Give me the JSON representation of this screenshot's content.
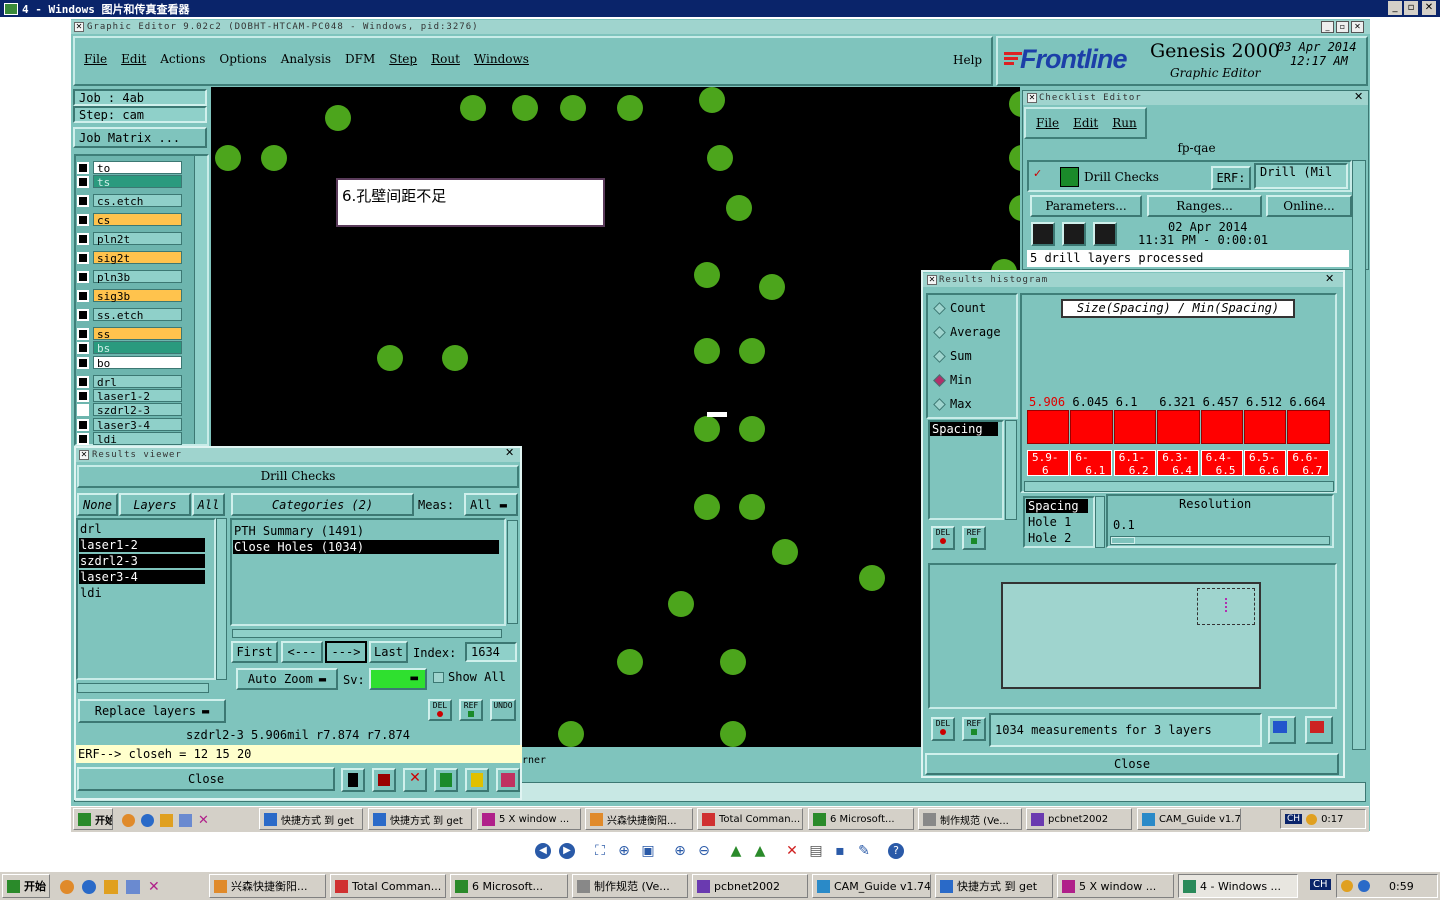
{
  "viewer_title": "4 - Windows 图片和传真查看器",
  "editor": {
    "title": "Graphic Editor 9.02c2 (DOBHT-HTCAM-PC048 - Windows, pid:3276)",
    "menu": [
      "File",
      "Edit",
      "Actions",
      "Options",
      "Analysis",
      "DFM",
      "Step",
      "Rout",
      "Windows"
    ],
    "help": "Help",
    "brand": "Frontline",
    "product": "Genesis 2000",
    "product_sub": "Graphic Editor",
    "date": "03 Apr 2014",
    "time": "12:17 AM",
    "job": "Job : 4ab",
    "step": "Step: cam",
    "job_matrix": "Job Matrix ...",
    "layers": [
      {
        "name": "to",
        "color": "#ffffff"
      },
      {
        "name": "ts",
        "color": "#2a9a7e"
      },
      {
        "name": "cs.etch",
        "color": "#8fd0c9"
      },
      {
        "name": "cs",
        "color": "#ffc34d"
      },
      {
        "name": "pln2t",
        "color": "#8fd0c9"
      },
      {
        "name": "sig2t",
        "color": "#ffc34d"
      },
      {
        "name": "pln3b",
        "color": "#8fd0c9"
      },
      {
        "name": "sig3b",
        "color": "#ffc34d"
      },
      {
        "name": "ss.etch",
        "color": "#8fd0c9"
      },
      {
        "name": "ss",
        "color": "#ffc34d"
      },
      {
        "name": "bs",
        "color": "#2a9a7e"
      },
      {
        "name": "bo",
        "color": "#ffffff"
      },
      {
        "name": "drl",
        "color": "#8fd0c9"
      },
      {
        "name": "laser1-2",
        "color": "#8fd0c9"
      },
      {
        "name": "szdrl2-3",
        "color": "#8fd0c9"
      },
      {
        "name": "laser3-4",
        "color": "#8fd0c9"
      },
      {
        "name": "ldi",
        "color": "#8fd0c9"
      }
    ],
    "annotation": "6.孔壁间距不足",
    "status_fragment": "rner"
  },
  "checklist": {
    "title": "Checklist Editor",
    "menu": [
      "File",
      "Edit",
      "Run"
    ],
    "name": "fp-qae",
    "check_name": "Drill Checks",
    "erf_label": "ERF:",
    "erf_value": "Drill (Mil",
    "params": "Parameters...",
    "ranges": "Ranges...",
    "online": "Online...",
    "run_date": "02 Apr 2014",
    "run_time": "11:31 PM - 0:00:01",
    "status": "5 drill layers processed"
  },
  "histogram": {
    "title": "Results histogram",
    "modes": [
      "Count",
      "Average",
      "Sum",
      "Min",
      "Max"
    ],
    "selected_mode": "Min",
    "header": "Size(Spacing) / Min(Spacing)",
    "spacing_list": [
      "Spacing"
    ],
    "bottom_list": [
      "Spacing",
      "Hole 1",
      "Hole 2"
    ],
    "resolution_label": "Resolution",
    "resolution_value": "0.1",
    "summary": "1034 measurements for 3 layers",
    "close": "Close",
    "del": "DEL",
    "ref": "REF"
  },
  "chart_data": {
    "type": "bar",
    "title": "Size(Spacing) / Min(Spacing)",
    "categories": [
      "5.9-6",
      "6-6.1",
      "6.1-6.2",
      "6.3-6.4",
      "6.4-6.5",
      "6.5-6.6",
      "6.6-6.7"
    ],
    "values": [
      5.906,
      6.045,
      6.1,
      6.321,
      6.457,
      6.512,
      6.664
    ],
    "value_labels": [
      "5.906",
      "6.045",
      "6.1",
      "6.321",
      "6.457",
      "6.512",
      "6.664"
    ],
    "bar_color": "#ff0000"
  },
  "results_viewer": {
    "title": "Results viewer",
    "heading": "Drill Checks",
    "none": "None",
    "layers": "Layers",
    "all": "All",
    "categories": "Categories (2)",
    "meas": "Meas:",
    "meas_value": "All",
    "layer_list": [
      "drl",
      "laser1-2",
      "szdrl2-3",
      "laser3-4",
      "ldi"
    ],
    "selected_layers": [
      "laser1-2",
      "szdrl2-3",
      "laser3-4"
    ],
    "category_list": [
      "PTH Summary (1491)",
      "Close Holes (1034)"
    ],
    "selected_category": "Close Holes (1034)",
    "first": "First",
    "prev": "<---",
    "next": "--->",
    "last": "Last",
    "index_label": "Index:",
    "index_value": "1634",
    "auto_zoom": "Auto Zoom",
    "sv": "Sv:",
    "show_all": "Show All",
    "replace_layers": "Replace layers",
    "del": "DEL",
    "ref": "REF",
    "undo": "UNDO",
    "result_line": "szdrl2-3 5.906mil   r7.874   r7.874",
    "erf_line": "ERF--> closeh = 12 15 20",
    "close": "Close"
  },
  "inner_taskbar": {
    "start": "开始",
    "items": [
      "快捷方式 到 get",
      "快捷方式 到 get",
      "5 X window ...",
      "兴森快捷衡阳...",
      "Total Comman...",
      "6 Microsoft...",
      "制作规范 (Ve...",
      "pcbnet2002",
      "CAM_Guide v1.74"
    ],
    "lang": "CH",
    "clock": "0:17"
  },
  "outer_taskbar": {
    "start": "开始",
    "items": [
      "兴森快捷衡阳...",
      "Total Comman...",
      "6 Microsoft...",
      "制作规范 (Ve...",
      "pcbnet2002",
      "CAM_Guide v1.74",
      "快捷方式 到 get",
      "5 X window ...",
      "4 - Windows ..."
    ],
    "lang": "CH",
    "clock": "0:59"
  }
}
